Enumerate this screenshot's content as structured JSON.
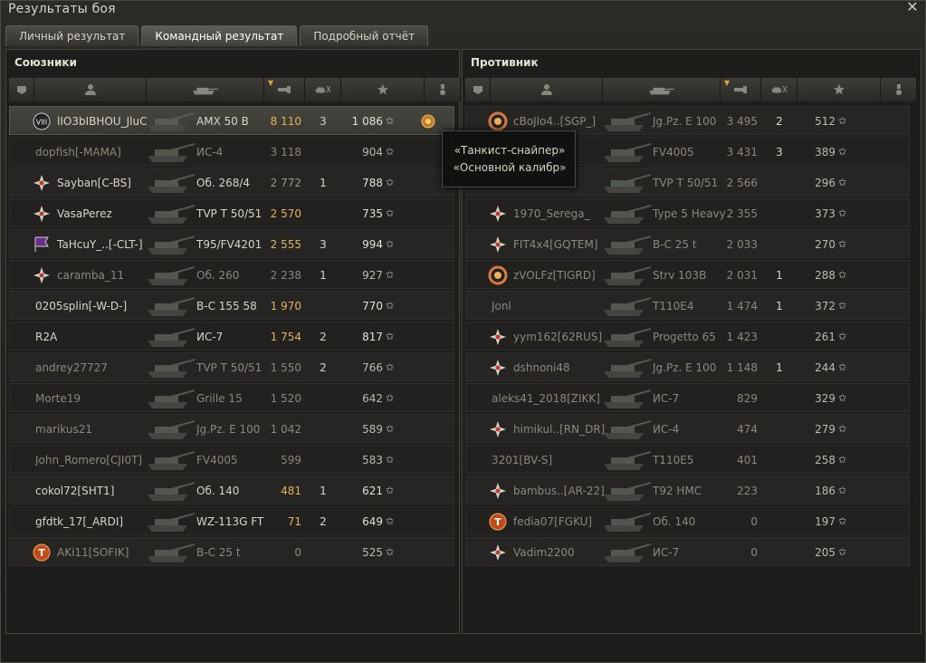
{
  "window": {
    "title": "Результаты боя"
  },
  "tabs": [
    {
      "label": "Личный результат",
      "active": false
    },
    {
      "label": "Командный результат",
      "active": true
    },
    {
      "label": "Подробный отчёт",
      "active": false
    }
  ],
  "allies": {
    "title": "Союзники",
    "rows": [
      {
        "name": "lIO3bIBHOU_JluC",
        "tank": "AMX 50 B",
        "damage": "8 110",
        "frags": "3",
        "xp": "1 086",
        "badge": "class-VIII-icon",
        "me": true,
        "dim": false,
        "gold": true,
        "medal": true
      },
      {
        "name": "dopfish[-MAMA]",
        "tank": "ИС-4",
        "damage": "3 118",
        "frags": "",
        "xp": "904",
        "badge": "",
        "dim": true
      },
      {
        "name": "Sayban[C-BS]",
        "tank": "Об. 268/4",
        "damage": "2 772",
        "frags": "1",
        "xp": "788",
        "badge": "mastery-badge-icon",
        "dim": false
      },
      {
        "name": "VasaPerez",
        "tank": "TVP T 50/51",
        "damage": "2 570",
        "frags": "",
        "xp": "735",
        "badge": "mastery-badge-icon",
        "dim": false,
        "gold": true
      },
      {
        "name": "TaHcuY_..[-CLT-]",
        "tank": "T95/FV4201",
        "damage": "2 555",
        "frags": "3",
        "xp": "994",
        "badge": "clan-flag-icon",
        "dim": false,
        "gold": true
      },
      {
        "name": "caramba_11",
        "tank": "Об. 260",
        "damage": "2 238",
        "frags": "1",
        "xp": "927",
        "badge": "mastery-badge-icon",
        "dim": true
      },
      {
        "name": "0205splin[-W-D-]",
        "tank": "B-C 155 58",
        "damage": "1 970",
        "frags": "",
        "xp": "770",
        "badge": "",
        "dim": false,
        "gold": true
      },
      {
        "name": "R2A",
        "tank": "ИС-7",
        "damage": "1 754",
        "frags": "2",
        "xp": "817",
        "badge": "",
        "dim": false,
        "gold": true
      },
      {
        "name": "andrey27727",
        "tank": "TVP T 50/51",
        "damage": "1 550",
        "frags": "2",
        "xp": "766",
        "badge": "",
        "dim": true
      },
      {
        "name": "Morte19",
        "tank": "Grille 15",
        "damage": "1 520",
        "frags": "",
        "xp": "642",
        "badge": "",
        "dim": true
      },
      {
        "name": "marikus21",
        "tank": "Jg.Pz. E 100",
        "damage": "1 042",
        "frags": "",
        "xp": "589",
        "badge": "",
        "dim": true
      },
      {
        "name": "John_Romero[CJI0T]",
        "tank": "FV4005",
        "damage": "599",
        "frags": "",
        "xp": "583",
        "badge": "",
        "dim": true
      },
      {
        "name": "cokol72[SHT1]",
        "tank": "Об. 140",
        "damage": "481",
        "frags": "1",
        "xp": "621",
        "badge": "",
        "dim": false,
        "gold": true
      },
      {
        "name": "gfdtk_17[_ARDI]",
        "tank": "WZ-113G FT",
        "damage": "71",
        "frags": "2",
        "xp": "649",
        "badge": "",
        "dim": false,
        "gold": true
      },
      {
        "name": "AKi11[SOFIK]",
        "tank": "B-C 25 t",
        "damage": "0",
        "frags": "",
        "xp": "525",
        "badge": "rank-T-badge-icon",
        "dim": true
      }
    ]
  },
  "enemies": {
    "title": "Противник",
    "rows": [
      {
        "name": "cBoJlo4..[SGP_]",
        "tank": "Jg.Pz. E 100",
        "damage": "3 495",
        "frags": "2",
        "xp": "512",
        "badge": "wreath-badge-icon",
        "dim": true
      },
      {
        "name": "",
        "tank": "FV4005",
        "damage": "3 431",
        "frags": "3",
        "xp": "389",
        "badge": "",
        "dim": true
      },
      {
        "name": "",
        "tank": "TVP T 50/51",
        "damage": "2 566",
        "frags": "",
        "xp": "296",
        "badge": "",
        "dim": true
      },
      {
        "name": "1970_Serega_",
        "tank": "Type 5 Heavy",
        "damage": "2 355",
        "frags": "",
        "xp": "373",
        "badge": "mastery-badge-icon",
        "dim": true
      },
      {
        "name": "FIT4x4[GQTEM]",
        "tank": "B-C 25 t",
        "damage": "2 033",
        "frags": "",
        "xp": "270",
        "badge": "mastery-badge-icon",
        "dim": true
      },
      {
        "name": "zVOLFz[TIGRD]",
        "tank": "Strv 103B",
        "damage": "2 031",
        "frags": "1",
        "xp": "288",
        "badge": "wreath-badge-icon",
        "dim": true
      },
      {
        "name": "Jonl",
        "tank": "T110E4",
        "damage": "1 474",
        "frags": "1",
        "xp": "372",
        "badge": "",
        "dim": true
      },
      {
        "name": "yym162[62RUS]",
        "tank": "Progetto 65",
        "damage": "1 423",
        "frags": "",
        "xp": "261",
        "badge": "mastery-badge-icon",
        "dim": true
      },
      {
        "name": "dshnoni48",
        "tank": "Jg.Pz. E 100",
        "damage": "1 148",
        "frags": "1",
        "xp": "244",
        "badge": "mastery-badge-icon",
        "dim": true
      },
      {
        "name": "aleks41_2018[ZIKK]",
        "tank": "ИС-7",
        "damage": "829",
        "frags": "",
        "xp": "329",
        "badge": "",
        "dim": true
      },
      {
        "name": "himikul..[RN_DR]",
        "tank": "ИС-4",
        "damage": "474",
        "frags": "",
        "xp": "279",
        "badge": "mastery-badge-icon",
        "dim": true
      },
      {
        "name": "3201[BV-S]",
        "tank": "T110E5",
        "damage": "401",
        "frags": "",
        "xp": "258",
        "badge": "",
        "dim": true
      },
      {
        "name": "bambus..[AR-22]",
        "tank": "T92 HMC",
        "damage": "223",
        "frags": "",
        "xp": "186",
        "badge": "mastery-badge-icon",
        "dim": true
      },
      {
        "name": "fedia07[FGKU]",
        "tank": "Об. 140",
        "damage": "0",
        "frags": "",
        "xp": "197",
        "badge": "rank-T-badge-icon",
        "dim": true
      },
      {
        "name": "Vadim2200",
        "tank": "ИС-7",
        "damage": "0",
        "frags": "",
        "xp": "205",
        "badge": "mastery-badge-icon",
        "dim": true
      }
    ]
  },
  "tooltip": {
    "line1": "«Танкист-снайпер»",
    "line2": "«Основной калибр»"
  },
  "colors": {
    "gold_damage": "#e0b45a",
    "accent_sort": "#e0a030"
  }
}
